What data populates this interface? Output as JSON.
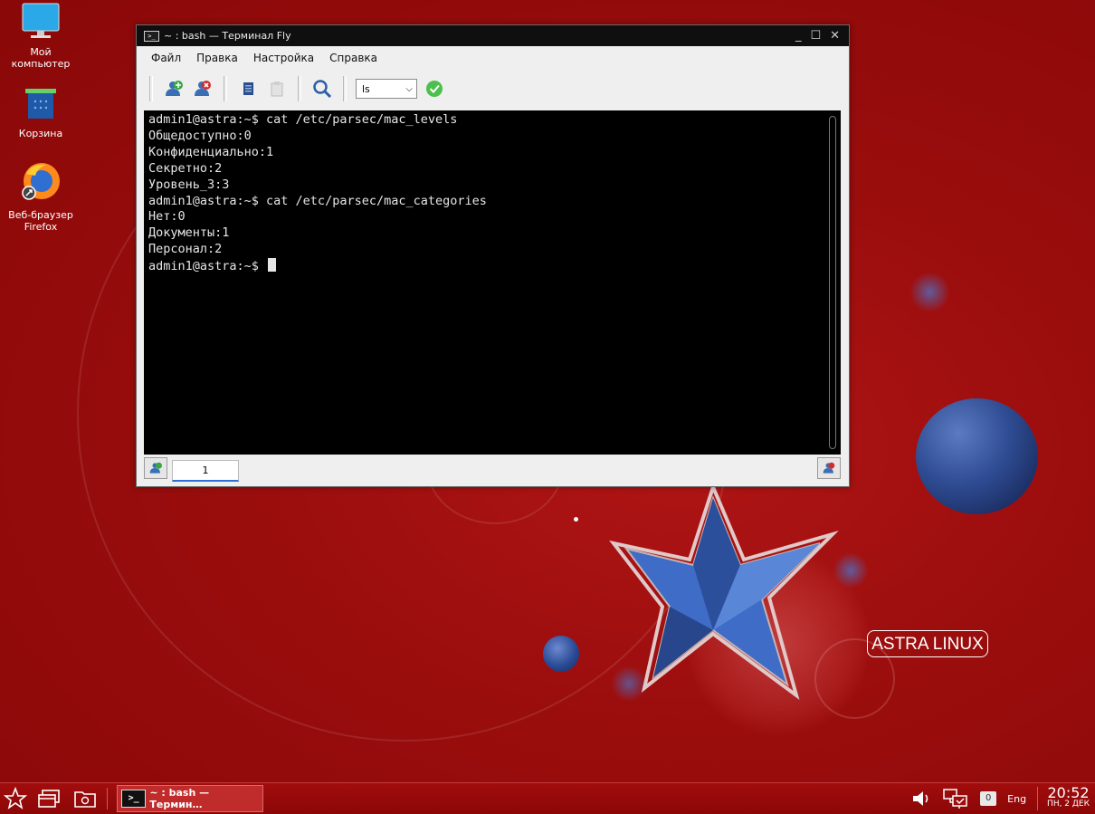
{
  "desktop": {
    "icons": [
      {
        "label_line1": "Мой",
        "label_line2": "компьютер",
        "icon": "monitor-icon"
      },
      {
        "label_line1": "Корзина",
        "label_line2": "",
        "icon": "trash-icon"
      },
      {
        "label_line1": "Веб-браузер",
        "label_line2": "Firefox",
        "icon": "firefox-icon"
      }
    ],
    "logo": "ASTRA LINUX"
  },
  "window": {
    "title": "~ : bash — Терминал Fly",
    "menu": [
      "Файл",
      "Правка",
      "Настройка",
      "Справка"
    ],
    "toolbar": {
      "combo_value": "ls",
      "icons": [
        "new-tab-icon",
        "close-tab-icon",
        "copy-icon",
        "paste-icon",
        "search-icon",
        "run-icon"
      ]
    },
    "terminal_lines": [
      "admin1@astra:~$ cat /etc/parsec/mac_levels",
      "Общедоступно:0",
      "Конфиденциально:1",
      "Секретно:2",
      "Уровень_3:3",
      "admin1@astra:~$ cat /etc/parsec/mac_categories",
      "Нет:0",
      "Документы:1",
      "Персонал:2",
      "admin1@astra:~$ "
    ],
    "tabs": [
      "1"
    ]
  },
  "taskbar": {
    "app_label": "~ : bash — Термин…",
    "keyboard_count": "0",
    "layout": "Eng",
    "time": "20:52",
    "date": "ПН, 2 ДЕК"
  },
  "colors": {
    "background": "#9a0d0d",
    "terminal_bg": "#000000",
    "terminal_fg": "#e6e6e6",
    "accent": "#2b6fd6"
  }
}
